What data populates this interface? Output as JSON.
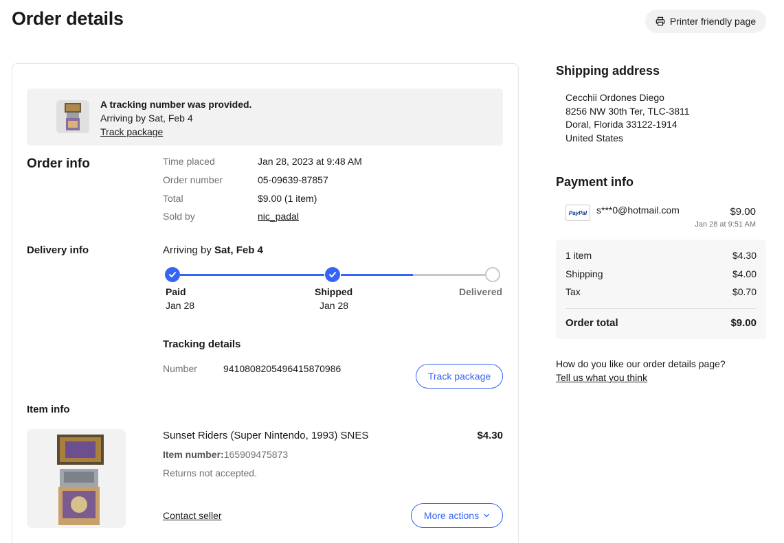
{
  "page": {
    "title": "Order details",
    "printer_label": "Printer friendly page"
  },
  "banner": {
    "headline": "A tracking number was provided.",
    "arriving": "Arriving by Sat, Feb 4",
    "track_link": "Track package"
  },
  "order_info": {
    "title": "Order info",
    "rows": [
      {
        "label": "Time placed",
        "value": "Jan 28, 2023 at 9:48 AM"
      },
      {
        "label": "Order number",
        "value": "05-09639-87857"
      },
      {
        "label": "Total",
        "value": "$9.00 (1 item)"
      },
      {
        "label": "Sold by",
        "value": "nic_padal"
      }
    ]
  },
  "delivery": {
    "title": "Delivery info",
    "arriving_prefix": "Arriving by ",
    "arriving_date": "Sat, Feb 4",
    "steps": [
      {
        "label": "Paid",
        "date": "Jan 28",
        "status": "done"
      },
      {
        "label": "Shipped",
        "date": "Jan 28",
        "status": "done"
      },
      {
        "label": "Delivered",
        "date": "",
        "status": "pending"
      }
    ],
    "progress_fraction_after_shipped": 0.5,
    "tracking_title": "Tracking details",
    "number_label": "Number",
    "number_value": "9410808205496415870986",
    "track_button": "Track package"
  },
  "item": {
    "section_title": "Item info",
    "name": "Sunset Riders (Super Nintendo, 1993) SNES",
    "price": "$4.30",
    "number_label": "Item number:",
    "number_value": "165909475873",
    "returns": "Returns not accepted.",
    "contact_link": "Contact seller",
    "more_actions": "More actions"
  },
  "shipping": {
    "title": "Shipping address",
    "lines": [
      "Cecchii Ordones Diego",
      "8256 NW 30th Ter, TLC-3811",
      "Doral, Florida 33122-1914",
      "United States"
    ]
  },
  "payment": {
    "title": "Payment info",
    "method_logo": "PayPal",
    "email": "s***0@hotmail.com",
    "amount": "$9.00",
    "date": "Jan 28 at 9:51 AM",
    "summary": [
      {
        "label": "1 item",
        "value": "$4.30"
      },
      {
        "label": "Shipping",
        "value": "$4.00"
      },
      {
        "label": "Tax",
        "value": "$0.70"
      }
    ],
    "total_label": "Order total",
    "total_value": "$9.00"
  },
  "feedback": {
    "question": "How do you like our order details page?",
    "link": "Tell us what you think"
  },
  "colors": {
    "accent": "#3665f3",
    "track_gray": "#c7c7c7"
  }
}
